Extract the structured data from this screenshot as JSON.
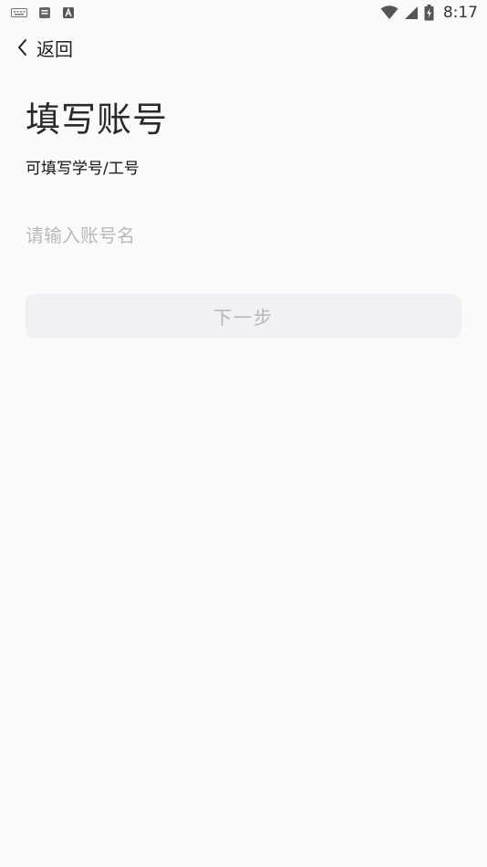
{
  "status_bar": {
    "time": "8:17",
    "left_icons": [
      "keyboard-icon",
      "notification-icon",
      "text-a-icon"
    ],
    "right_icons": [
      "wifi-icon",
      "signal-icon",
      "battery-charging-icon"
    ]
  },
  "nav": {
    "back_label": "返回",
    "back_icon": "chevron-left-icon"
  },
  "main": {
    "title": "填写账号",
    "subtitle": "可填写学号/工号",
    "account_input": {
      "value": "",
      "placeholder": "请输入账号名"
    },
    "next_button_label": "下一步"
  },
  "colors": {
    "background": "#fafafa",
    "button_bg": "#f0f1f5",
    "button_text": "#b3b5bb",
    "placeholder": "#b7b9bf"
  }
}
